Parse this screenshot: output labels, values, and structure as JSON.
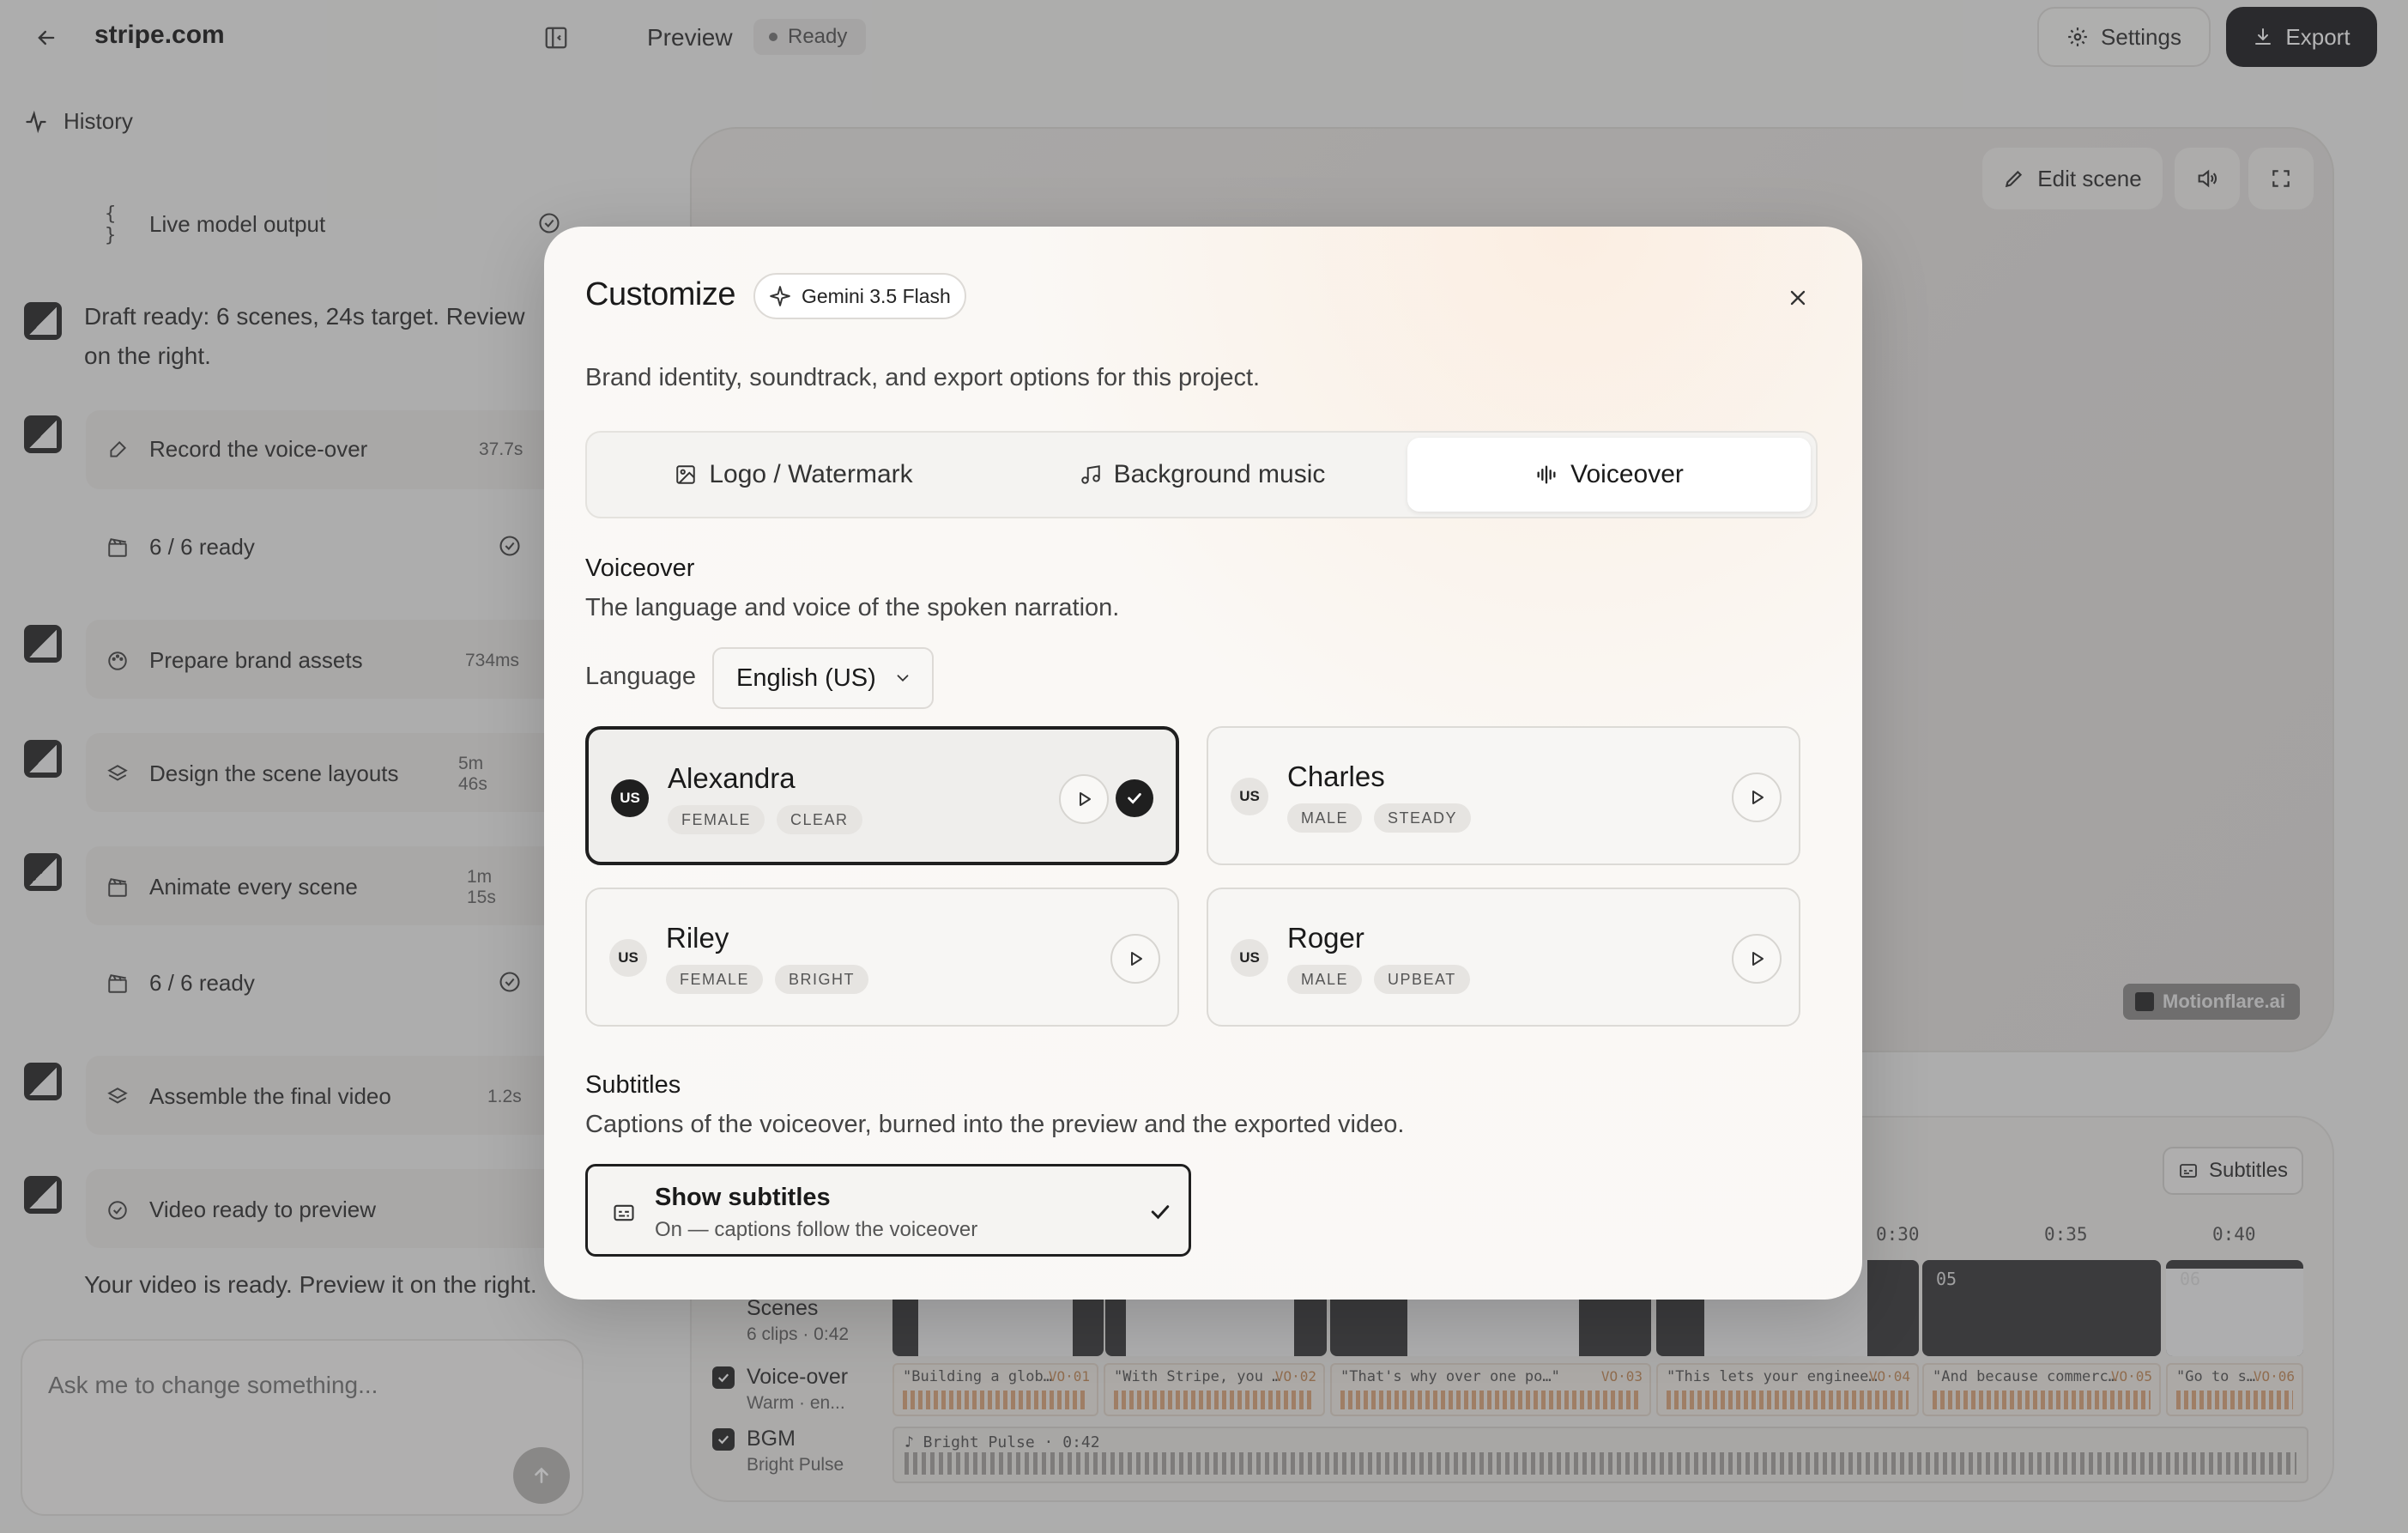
{
  "app": {
    "site_title": "stripe.com",
    "preview_label": "Preview",
    "status_badge": "Ready",
    "settings_label": "Settings",
    "export_label": "Export"
  },
  "history": {
    "title": "History",
    "rows": [
      {
        "label": "Live model output",
        "duration": ""
      },
      {
        "label": "Record the voice-over",
        "duration": "37.7s"
      },
      {
        "label": "6 / 6 ready",
        "duration": ""
      },
      {
        "label": "Prepare brand assets",
        "duration": "734ms"
      },
      {
        "label": "Design the scene layouts",
        "duration": "5m 46s"
      },
      {
        "label": "Animate every scene",
        "duration": "1m 15s"
      },
      {
        "label": "6 / 6 ready",
        "duration": ""
      },
      {
        "label": "Assemble the final video",
        "duration": "1.2s"
      },
      {
        "label": "Video ready to preview",
        "duration": ""
      }
    ],
    "message_draft_line1": "Draft ready: 6 scenes, 24s target. Review",
    "message_draft_line2": "on the right.",
    "message_final": "Your video is ready. Preview it on the right."
  },
  "chat": {
    "placeholder": "Ask me to change something..."
  },
  "stage": {
    "edit_scene_label": "Edit scene",
    "watermark_text": "Motionflare.ai"
  },
  "timeline": {
    "subtitles_button": "Subtitles",
    "ticks": [
      "0:30",
      "0:35",
      "0:40"
    ],
    "scene_numbers": [
      "05",
      "06"
    ],
    "tracks": {
      "scenes": {
        "name": "Scenes",
        "sub": "6 clips · 0:42"
      },
      "voiceover": {
        "name": "Voice-over",
        "sub": "Warm · en..."
      },
      "bgm": {
        "name": "BGM",
        "sub": "Bright Pulse"
      }
    },
    "vo_clips": [
      {
        "text": "\"Building a glob…",
        "tag": "VO·01"
      },
      {
        "text": "\"With Stripe, you …",
        "tag": "VO·02"
      },
      {
        "text": "\"That's why over one po…\"",
        "tag": "VO·03"
      },
      {
        "text": "\"This lets your enginee…",
        "tag": "VO·04"
      },
      {
        "text": "\"And because commerc…",
        "tag": "VO·05"
      },
      {
        "text": "\"Go to s…",
        "tag": "VO·06"
      }
    ],
    "bgm_clip": "♪ Bright Pulse · 0:42"
  },
  "modal": {
    "title": "Customize",
    "model_badge": "Gemini 3.5 Flash",
    "description": "Brand identity, soundtrack, and export options for this project.",
    "tabs": [
      {
        "label": "Logo / Watermark",
        "icon": "image-icon"
      },
      {
        "label": "Background music",
        "icon": "music-icon"
      },
      {
        "label": "Voiceover",
        "icon": "audio-waveform-icon",
        "active": true
      }
    ],
    "voiceover": {
      "title": "Voiceover",
      "description": "The language and voice of the spoken narration.",
      "language_label": "Language",
      "language_value": "English (US)",
      "voices": [
        {
          "flag": "US",
          "name": "Alexandra",
          "tags": [
            "FEMALE",
            "CLEAR"
          ],
          "selected": true
        },
        {
          "flag": "US",
          "name": "Charles",
          "tags": [
            "MALE",
            "STEADY"
          ],
          "selected": false
        },
        {
          "flag": "US",
          "name": "Riley",
          "tags": [
            "FEMALE",
            "BRIGHT"
          ],
          "selected": false
        },
        {
          "flag": "US",
          "name": "Roger",
          "tags": [
            "MALE",
            "UPBEAT"
          ],
          "selected": false
        }
      ]
    },
    "subtitles": {
      "title": "Subtitles",
      "description": "Captions of the voiceover, burned into the preview and the exported video.",
      "toggle_title": "Show subtitles",
      "toggle_sub": "On — captions follow the voiceover",
      "enabled": true
    }
  },
  "colors": {
    "accent_dark": "#1f1f1f",
    "overlay": "#3c3c3e",
    "vo_wave": "#d79a6a"
  }
}
